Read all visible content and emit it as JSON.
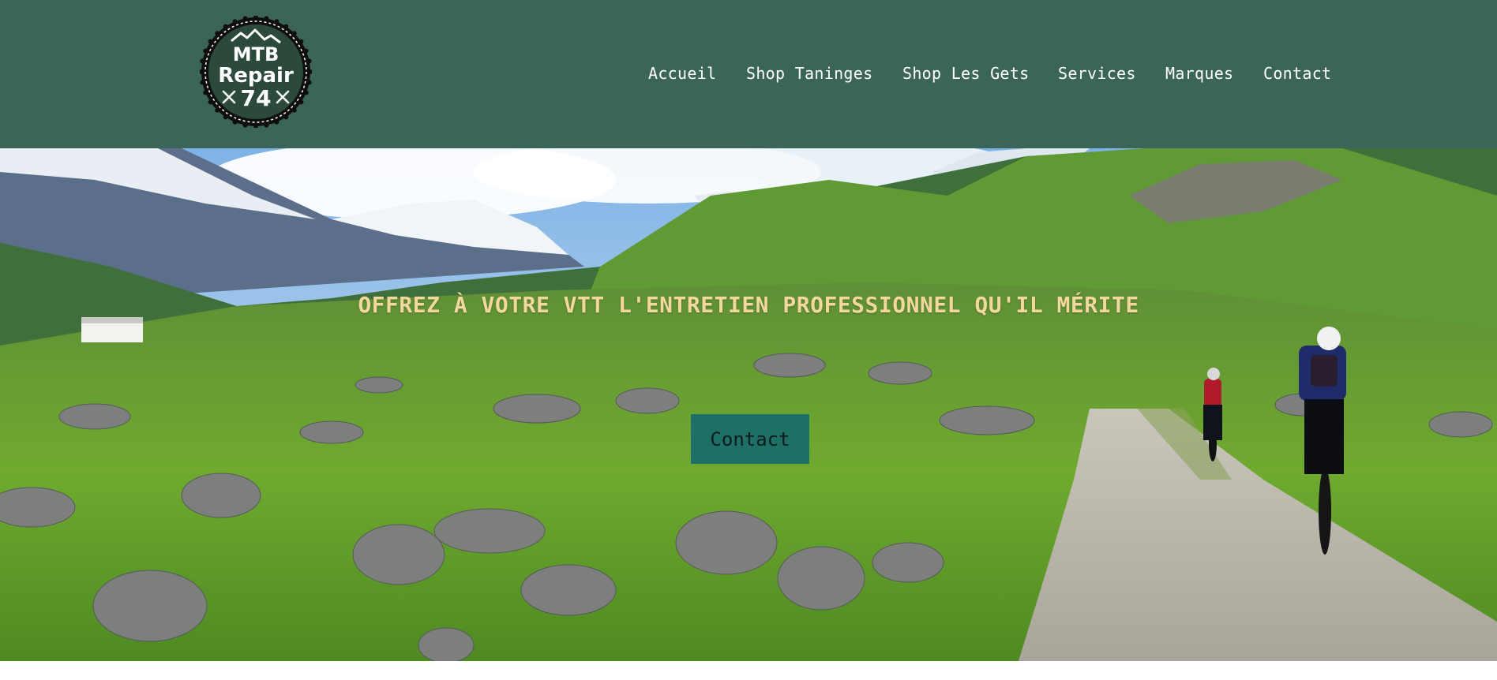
{
  "header": {
    "background_color": "#3c655a",
    "logo": {
      "line1": "MTB",
      "line2": "Repair",
      "line3": "74"
    },
    "nav": [
      {
        "label": "Accueil"
      },
      {
        "label": "Shop Taninges"
      },
      {
        "label": "Shop Les Gets"
      },
      {
        "label": "Services"
      },
      {
        "label": "Marques"
      },
      {
        "label": "Contact"
      }
    ]
  },
  "hero": {
    "image_icon": "mountain-bike-landscape-photo",
    "tagline": "OFFREZ À VOTRE VTT L'ENTRETIEN PROFESSIONNEL QU'IL MÉRITE",
    "tagline_color": "#f3d89e",
    "cta_label": "Contact",
    "cta_color": "#1f6f69"
  }
}
